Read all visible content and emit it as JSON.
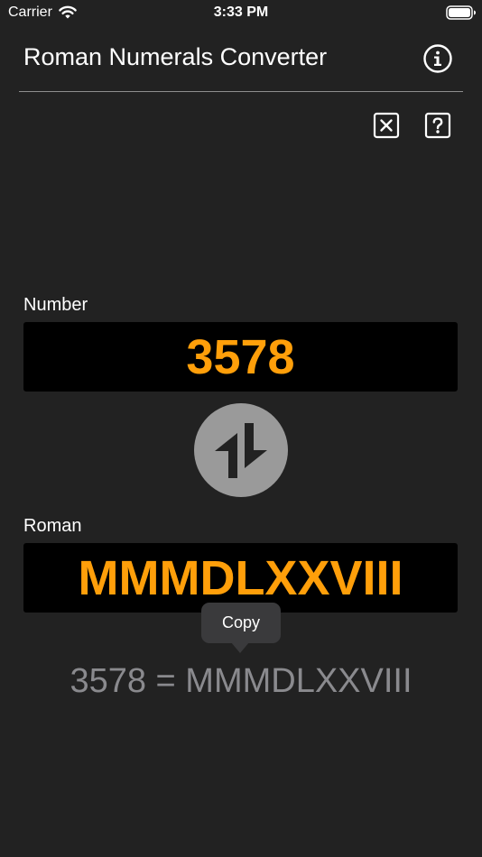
{
  "status_bar": {
    "carrier": "Carrier",
    "time": "3:33 PM",
    "wifi_icon": "wifi-icon",
    "battery_icon": "battery-icon"
  },
  "nav": {
    "title": "Roman Numerals Converter",
    "info_icon": "info-circle-icon"
  },
  "toolbar": {
    "clear_icon": "clear-x-icon",
    "help_icon": "question-mark-icon"
  },
  "number": {
    "label": "Number",
    "value": "3578"
  },
  "swap": {
    "icon": "swap-arrows-icon"
  },
  "roman": {
    "label": "Roman",
    "value": "MMMDLXXVIII"
  },
  "tooltip": {
    "label": "Copy"
  },
  "result": {
    "text": "3578 = MMMDLXXVIII"
  },
  "colors": {
    "background": "#222222",
    "field_background": "#000000",
    "accent": "#ff9f0a",
    "swap_button": "#9a9a9a",
    "result_text": "#8a8a8e",
    "tooltip": "#3a3a3c"
  }
}
